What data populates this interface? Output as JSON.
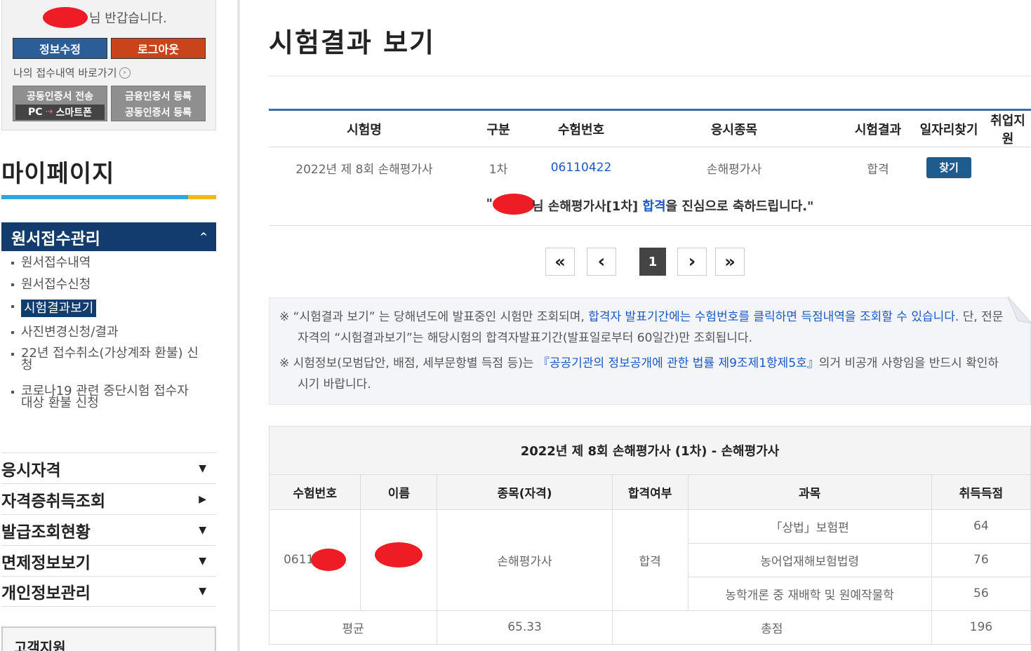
{
  "sidebar": {
    "greeting": "님 반갑습니다.",
    "edit_label": "정보수정",
    "logout_label": "로그아웃",
    "my_applications_link": "나의 접수내역 바로가기",
    "cert_send": {
      "line1": "공동인증서 전송",
      "pc": "PC",
      "device": "스마트폰"
    },
    "cert_register": {
      "line1": "금융인증서 등록",
      "line2": "공동인증서 등록"
    },
    "mypage_title": "마이페이지",
    "active_menu": "원서접수관리",
    "sub_items": [
      {
        "label": "원서접수내역"
      },
      {
        "label": "원서접수신청"
      },
      {
        "label": "시험결과보기"
      },
      {
        "label": "사진변경신청/결과"
      },
      {
        "label": "22년 접수취소(가상계좌 환불) 신청"
      },
      {
        "label": "코로나19 관련 중단시험 접수자 대상 환불 신청"
      }
    ],
    "menu_items": [
      {
        "label": "응시자격",
        "chevron": "▼"
      },
      {
        "label": "자격증취득조회",
        "chevron": "▶"
      },
      {
        "label": "발급조회현황",
        "chevron": "▼"
      },
      {
        "label": "면제정보보기",
        "chevron": "▼"
      },
      {
        "label": "개인정보관리",
        "chevron": "▼"
      }
    ],
    "customer_support": "고객지원"
  },
  "main": {
    "page_title": "시험결과 보기",
    "result_table": {
      "headers": [
        "시험명",
        "구분",
        "수험번호",
        "응시종목",
        "시험결과",
        "일자리찾기",
        "취업지원"
      ],
      "row": {
        "exam_name": "2022년 제 8회 손해평가사",
        "round": "1차",
        "exam_number": "06110422",
        "subject": "손해평가사",
        "result": "합격",
        "find_label": "찾기",
        "support": ""
      }
    },
    "congrats": {
      "quote_open": "\"",
      "part1": "님 손해평가사[1차] ",
      "pass_word": "합격",
      "part2": "을 진심으로 축하드립니다.\""
    },
    "pagination": {
      "first": "«",
      "prev": "‹",
      "current": "1",
      "next": "›",
      "last": "»"
    },
    "notice": {
      "p1_mark": "※",
      "p1_a": " “시험결과 보기” 는 당해년도에 발표중인 시험만 조회되며, ",
      "p1_blue": "합격자 발표기간에는 수험번호를 클릭하면 득점내역을 조회할 수 있습니다.",
      "p1_b": " 단, 전문자격의 “시험결과보기”는 해당시험의 합격자발표기간(발표일로부터 60일간)만 조회됩니다.",
      "p2_mark": "※",
      "p2_a": " 시험정보(모범답안, 배점, 세부문항별 득점 등)는 ",
      "p2_blue": "『공공기관의 정보공개에 관한 법률 제9조제1항제5호』",
      "p2_b": "의거 비공개 사항임을 반드시 확인하시기 바랍니다."
    },
    "detail": {
      "title": "2022년 제 8회 손해평가사 (1차) - 손해평가사",
      "headers": [
        "수험번호",
        "이름",
        "종목(자격)",
        "합격여부",
        "과목",
        "취득득점"
      ],
      "exam_number_masked": "0611",
      "item": "손해평가사",
      "pass_status": "합격",
      "subjects": [
        {
          "name": "「상법」보험편",
          "score": "64"
        },
        {
          "name": "농어업재해보험법령",
          "score": "76"
        },
        {
          "name": "농학개론 중 재배학 및 원예작물학",
          "score": "56"
        }
      ],
      "average_label": "평균",
      "average_value": "65.33",
      "total_label": "총점",
      "total_value": "196"
    }
  },
  "colors": {
    "navy": "#113c6b",
    "link_blue": "#1a57c7",
    "logout_orange": "#c9441a",
    "edit_blue": "#2b5d96",
    "redaction_red": "#ee1c24"
  }
}
